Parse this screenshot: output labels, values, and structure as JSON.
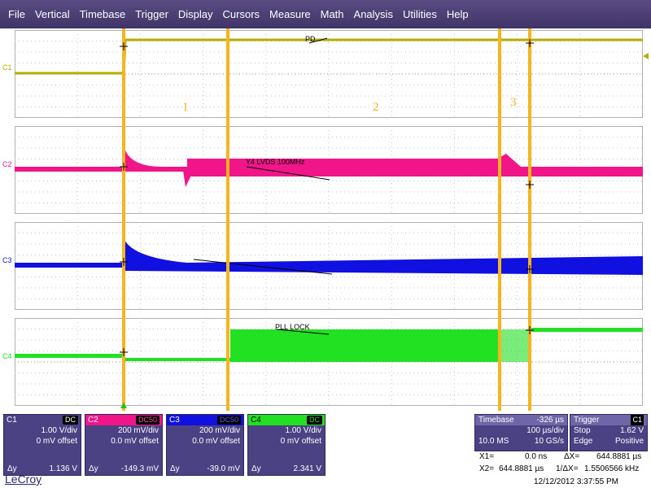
{
  "menu": [
    "File",
    "Vertical",
    "Timebase",
    "Trigger",
    "Display",
    "Cursors",
    "Measure",
    "Math",
    "Analysis",
    "Utilities",
    "Help"
  ],
  "waveform": {
    "channel_labels": [
      "C1",
      "C2",
      "C3",
      "C4"
    ],
    "trace_labels": [
      "PD",
      "Y4 LVDS 100MHz",
      "PLL LOCK"
    ],
    "markers": [
      "1",
      "2",
      "3"
    ],
    "colors": {
      "C1": "#b5ad00",
      "C2": "#f0168a",
      "C3": "#1010e0",
      "C4": "#22e022",
      "marker": "#f7b41f"
    }
  },
  "channels": [
    {
      "name": "C1",
      "coupling": "DC",
      "scale": "1.00 V/div",
      "offset": "0 mV offset",
      "dy_label": "Δy",
      "dy_value": "1.136 V",
      "color": "#b5ad00"
    },
    {
      "name": "C2",
      "coupling": "DC50",
      "scale": "200 mV/div",
      "offset": "0.0 mV offset",
      "dy_label": "Δy",
      "dy_value": "-149.3 mV",
      "color": "#f0168a"
    },
    {
      "name": "C3",
      "coupling": "DC50",
      "scale": "200 mV/div",
      "offset": "0.0 mV offset",
      "dy_label": "Δy",
      "dy_value": "-39.0 mV",
      "color": "#1010e0"
    },
    {
      "name": "C4",
      "coupling": "DC",
      "scale": "1.00 V/div",
      "offset": "0 mV offset",
      "dy_label": "Δy",
      "dy_value": "2.341 V",
      "color": "#22e022"
    }
  ],
  "timebase": {
    "label": "Timebase",
    "delay": "-326 µs",
    "per_div": "100 µs/div",
    "samples": "10.0 MS",
    "rate": "10 GS/s"
  },
  "trigger": {
    "label": "Trigger",
    "source": "C1",
    "mode": "Stop",
    "level": "1.62 V",
    "type": "Edge",
    "slope": "Positive"
  },
  "cursors": {
    "x1_label": "X1=",
    "x1_value": "0.0 ns",
    "dx_label": "ΔX=",
    "dx_value": "644.8881 µs",
    "x2_label": "X2=",
    "x2_value": "644.8881 µs",
    "inv_label": "1/ΔX=",
    "inv_value": "1.5506566 kHz"
  },
  "brand": "LeCroy",
  "datetime": "12/12/2012 3:37:55 PM"
}
